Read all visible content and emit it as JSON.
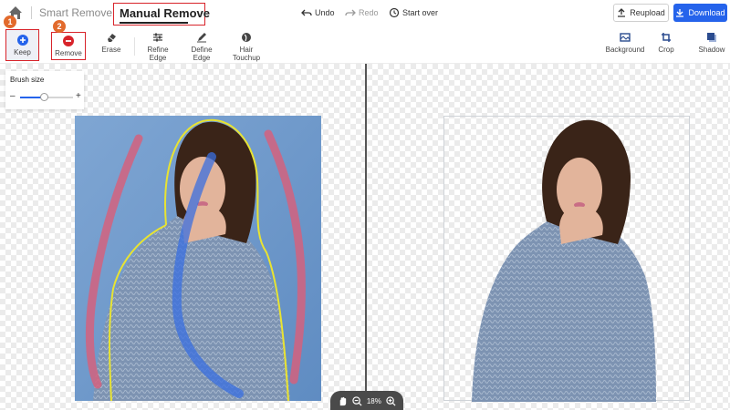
{
  "header": {
    "smart_remove": "Smart Remove",
    "manual_remove": "Manual Remove",
    "undo": "Undo",
    "redo": "Redo",
    "start_over": "Start over",
    "reupload": "Reupload",
    "download": "Download"
  },
  "toolbar": {
    "keep": "Keep",
    "remove": "Remove",
    "erase": "Erase",
    "refine_edge": "Refine Edge",
    "define_edge": "Define Edge",
    "hair_touchup": "Hair Touchup",
    "background": "Background",
    "crop": "Crop",
    "shadow": "Shadow",
    "badge_keep": "1",
    "badge_remove": "2"
  },
  "brush": {
    "title": "Brush size",
    "minus": "–",
    "plus": "+",
    "value_fraction": 0.45
  },
  "zoom": {
    "level": "18%"
  },
  "colors": {
    "accent": "#2563eb",
    "highlight": "#d8232a",
    "badge": "#e26a2c",
    "keep_stroke": "#3a6fe0",
    "remove_stroke": "#d4627e",
    "edge_outline": "#e8e332"
  }
}
